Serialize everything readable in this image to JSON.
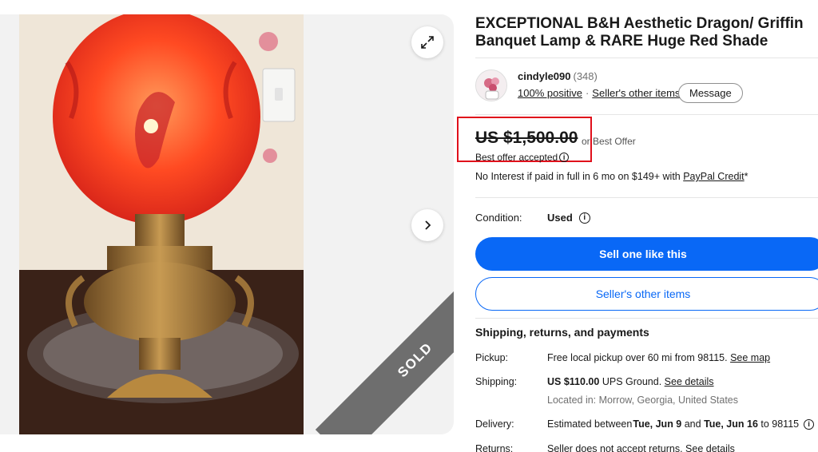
{
  "listing": {
    "title": "EXCEPTIONAL B&H Aesthetic Dragon/ Griffin Banquet Lamp & RARE Huge Red Shade",
    "sold_label": "SOLD"
  },
  "seller": {
    "name": "cindyle090",
    "feedback_count": "(348)",
    "positive": "100% positive",
    "other_items_link": "Seller's other items",
    "message_label": "Message"
  },
  "price": {
    "amount": "US $1,500.00",
    "best_offer": "or Best Offer",
    "accepted": "Best offer accepted",
    "paypal_prefix": "No Interest if paid in full in 6 mo on $149+ with ",
    "paypal_link": "PayPal Credit",
    "paypal_suffix": "*"
  },
  "condition": {
    "label": "Condition:",
    "value": "Used"
  },
  "actions": {
    "sell_one": "Sell one like this",
    "seller_other_items": "Seller's other items"
  },
  "shipping": {
    "heading": "Shipping, returns, and payments",
    "pickup_label": "Pickup:",
    "pickup_text": "Free local pickup over 60 mi from 98115.",
    "pickup_link": "See map",
    "shipping_label": "Shipping:",
    "shipping_price": "US $110.00",
    "shipping_service": "UPS Ground.",
    "shipping_link": "See details",
    "located": "Located in: Morrow, Georgia, United States",
    "delivery_label": "Delivery:",
    "delivery_prefix": "Estimated between ",
    "delivery_start": "Tue, Jun 9",
    "delivery_and": " and ",
    "delivery_end": "Tue, Jun 16",
    "delivery_suffix": " to 98115",
    "returns_label": "Returns:",
    "returns_text": "Seller does not accept returns.",
    "returns_link": "See details"
  },
  "colors": {
    "primary_blue": "#0968f6",
    "highlight_red": "#e0101b",
    "sold_gray": "#6e6e6e"
  },
  "icons": [
    "expand-icon",
    "chevron-right-icon",
    "info-icon"
  ]
}
